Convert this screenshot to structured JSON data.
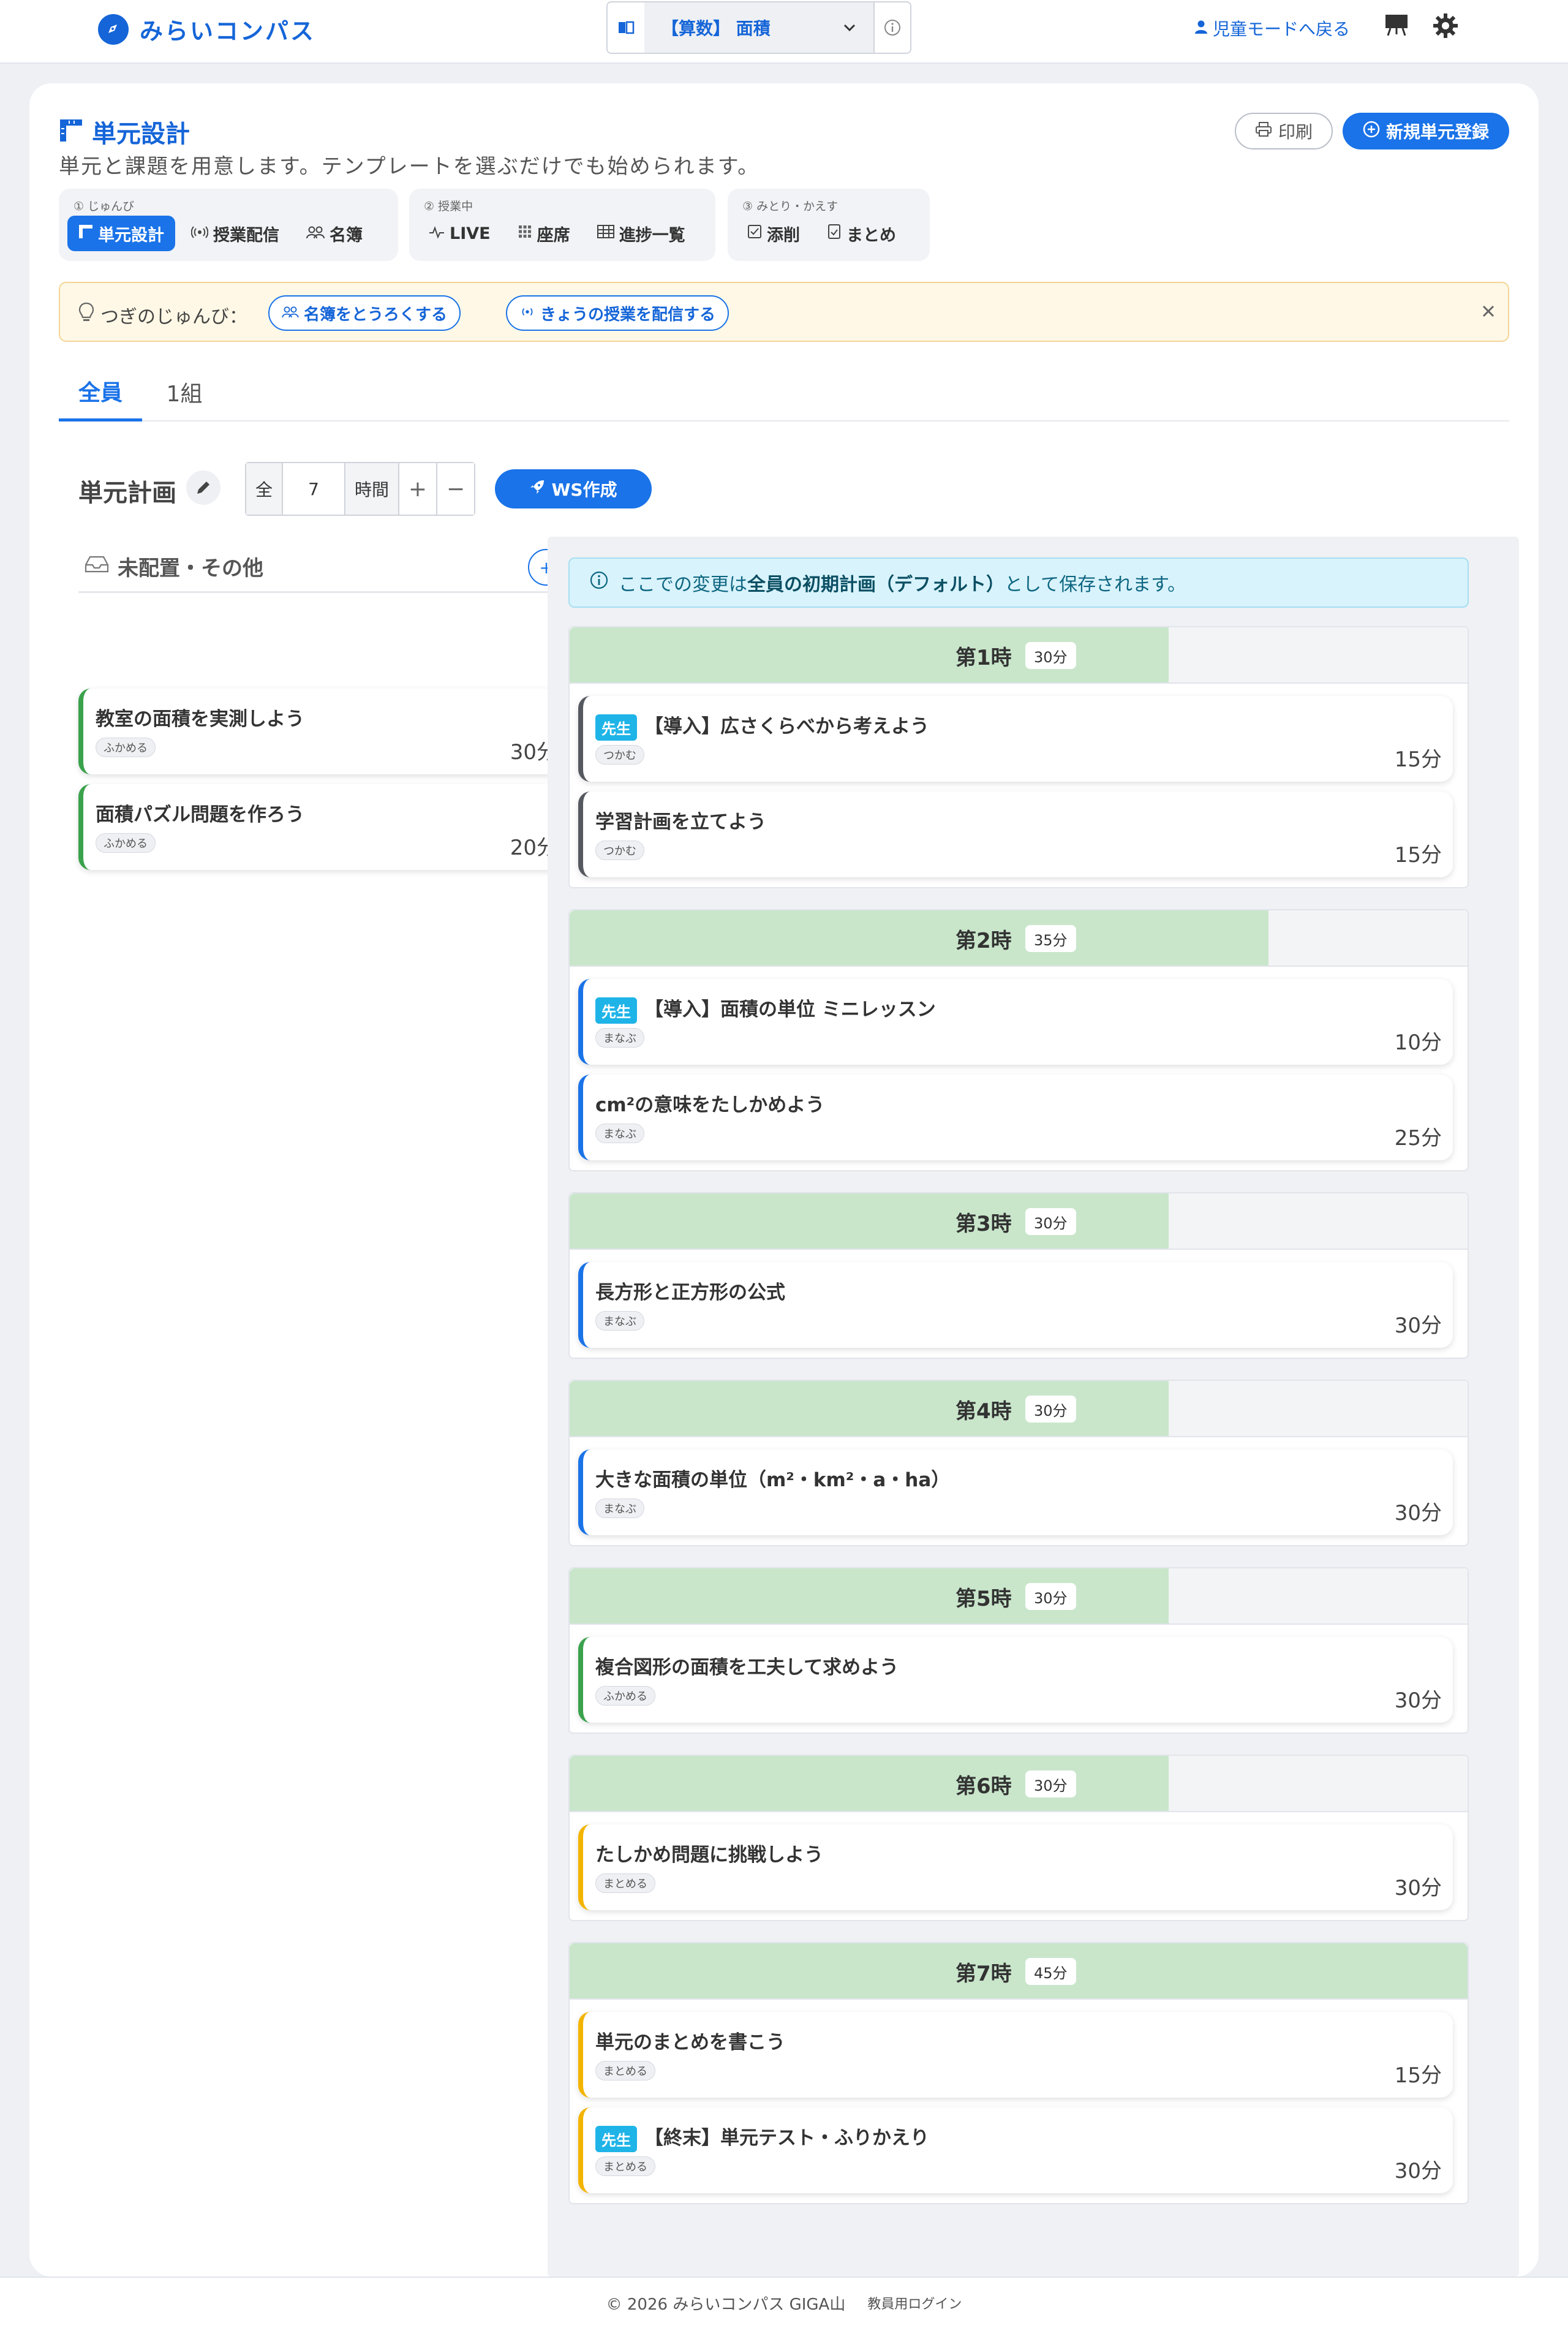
{
  "app": {
    "name": "みらいコンパス"
  },
  "header": {
    "subject": "【算数】 面積",
    "back_link": "児童モードへ戻る",
    "icons": {
      "subject": "book-icon",
      "info": "info-icon",
      "board": "board-icon",
      "settings": "gear-icon"
    }
  },
  "page": {
    "title": "単元設計",
    "subtitle": "単元と課題を用意します。テンプレートを選ぶだけでも始められます。",
    "print_label": "印刷",
    "new_label": "新規単元登録"
  },
  "steps": [
    {
      "label": "① じゅんび",
      "buttons": [
        "単元設計",
        "授業配信",
        "名簿"
      ]
    },
    {
      "label": "② 授業中",
      "buttons": [
        "LIVE",
        "座席",
        "進捗一覧"
      ]
    },
    {
      "label": "③ みとり・かえす",
      "buttons": [
        "添削",
        "まとめ"
      ]
    }
  ],
  "hint": {
    "label": "つぎのじゅんび：",
    "chips": [
      "名簿をとうろくする",
      "きょうの授業を配信する"
    ]
  },
  "tabs": [
    "全員",
    "1組"
  ],
  "plan": {
    "title": "単元計画",
    "prefix": "全",
    "hours": "7",
    "unit": "時間",
    "plus": "+",
    "minus": "−",
    "ws_label": "WS作成"
  },
  "unassigned": {
    "title": "未配置・その他",
    "add": "+",
    "items": [
      {
        "title": "教室の面積を実測しよう",
        "tag": "ふかめる",
        "time": "30分"
      },
      {
        "title": "面積パズル問題を作ろう",
        "tag": "ふかめる",
        "time": "20分"
      }
    ]
  },
  "notice": {
    "prefix": "ここでの変更は",
    "bold": "全員の初期計画（デフォルト）",
    "suffix": "として保存されます。"
  },
  "teacher_badge": "先生",
  "periods": [
    {
      "label": "第1時",
      "time": "30分",
      "fill": 0.667,
      "tasks": [
        {
          "teacher": true,
          "title": "【導入】広さくらべから考えよう",
          "tag": "つかむ",
          "time": "15分"
        },
        {
          "teacher": false,
          "title": "学習計画を立てよう",
          "tag": "つかむ",
          "time": "15分"
        }
      ]
    },
    {
      "label": "第2時",
      "time": "35分",
      "fill": 0.778,
      "tasks": [
        {
          "teacher": true,
          "title": "【導入】面積の単位 ミニレッスン",
          "tag": "まなぶ",
          "time": "10分"
        },
        {
          "teacher": false,
          "title": "cm²の意味をたしかめよう",
          "tag": "まなぶ",
          "time": "25分"
        }
      ]
    },
    {
      "label": "第3時",
      "time": "30分",
      "fill": 0.667,
      "tasks": [
        {
          "teacher": false,
          "title": "長方形と正方形の公式",
          "tag": "まなぶ",
          "time": "30分"
        }
      ]
    },
    {
      "label": "第4時",
      "time": "30分",
      "fill": 0.667,
      "tasks": [
        {
          "teacher": false,
          "title": "大きな面積の単位（m²・km²・a・ha）",
          "tag": "まなぶ",
          "time": "30分"
        }
      ]
    },
    {
      "label": "第5時",
      "time": "30分",
      "fill": 0.667,
      "tasks": [
        {
          "teacher": false,
          "title": "複合図形の面積を工夫して求めよう",
          "tag": "ふかめる",
          "time": "30分"
        }
      ]
    },
    {
      "label": "第6時",
      "time": "30分",
      "fill": 0.667,
      "tasks": [
        {
          "teacher": false,
          "title": "たしかめ問題に挑戦しよう",
          "tag": "まとめる",
          "time": "30分"
        }
      ]
    },
    {
      "label": "第7時",
      "time": "45分",
      "fill": 1.0,
      "tasks": [
        {
          "teacher": false,
          "title": "単元のまとめを書こう",
          "tag": "まとめる",
          "time": "15分"
        },
        {
          "teacher": true,
          "title": "【終末】単元テスト・ふりかえり",
          "tag": "まとめる",
          "time": "30分"
        }
      ]
    }
  ],
  "footer": {
    "copyright": "© 2026 みらいコンパス GIGA山",
    "login": "教員用ログイン"
  }
}
